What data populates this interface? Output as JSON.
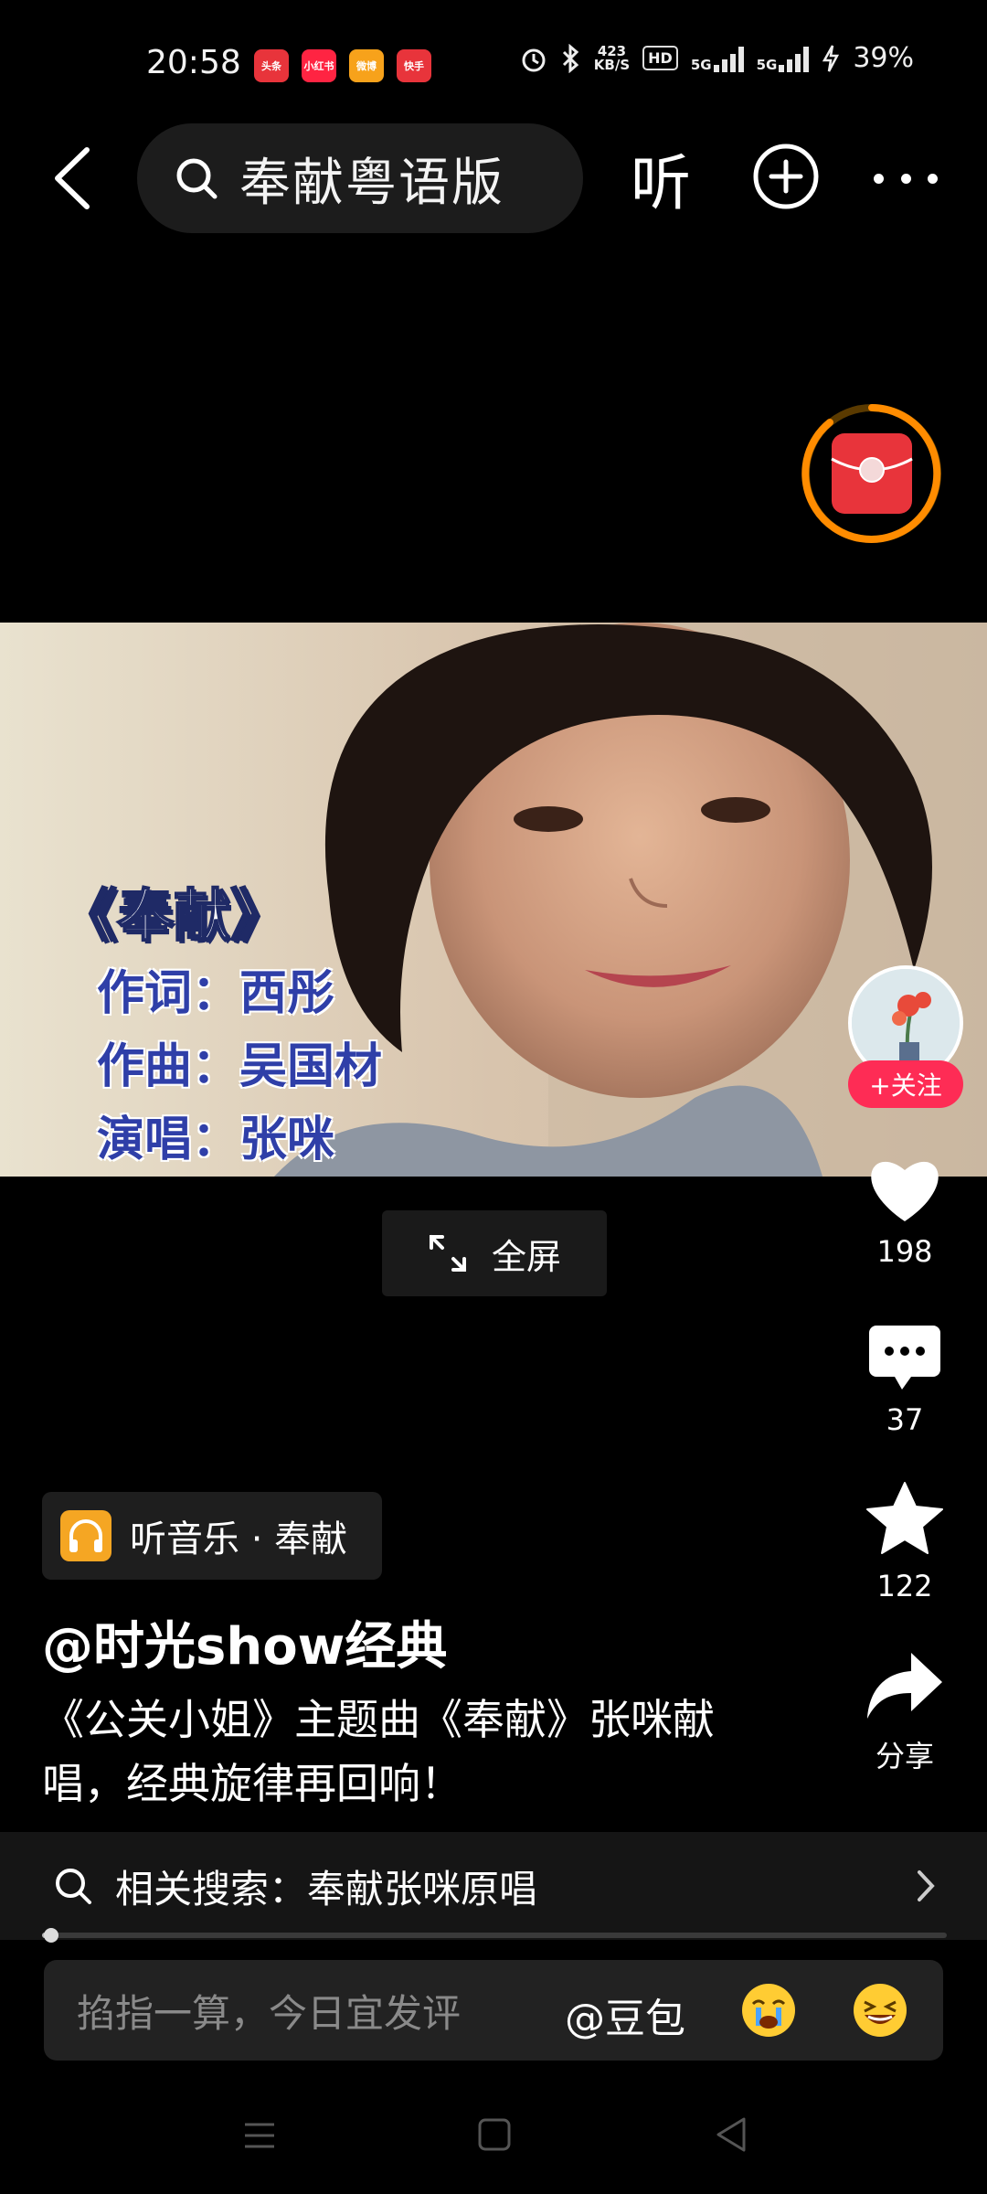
{
  "status_bar": {
    "time": "20:58",
    "app_badges": [
      {
        "label": "头条",
        "color": "#e8343b"
      },
      {
        "label": "小红书",
        "color": "#ff2442"
      },
      {
        "label": "微博",
        "color": "#f7a21b"
      },
      {
        "label": "快手",
        "color": "#e8343b"
      }
    ],
    "net_speed_value": "423",
    "net_speed_unit": "KB/S",
    "hd_label": "HD",
    "net_5g_a": "5G",
    "net_5g_b": "5G",
    "battery": "39%"
  },
  "top_bar": {
    "search_query": "奉献粤语版",
    "listen_label": "听"
  },
  "video": {
    "credits_title": "《奉献》",
    "lyricist": "作词：西彤",
    "composer": "作曲：吴国材",
    "singer": "演唱：张咪"
  },
  "fullscreen_label": "全屏",
  "actions": {
    "follow_label": "+关注",
    "likes": "198",
    "comments": "37",
    "favorites": "122",
    "share_label": "分享"
  },
  "music_chip_label": "听音乐 · 奉献",
  "author": "@时光show经典",
  "description": "《公关小姐》主题曲《奉献》张咪献唱，经典旋律再回响！",
  "related_search": "相关搜索：奉献张咪原唱",
  "progress_fraction": 0.01,
  "comment_bar": {
    "placeholder": "掐指一算，今日宜发评",
    "mention": "@豆包"
  },
  "colors": {
    "accent": "#fe2c55",
    "music_icon": "#f5a623",
    "red_packet": "#e8343b",
    "red_packet_ring": "#ff8c00"
  }
}
